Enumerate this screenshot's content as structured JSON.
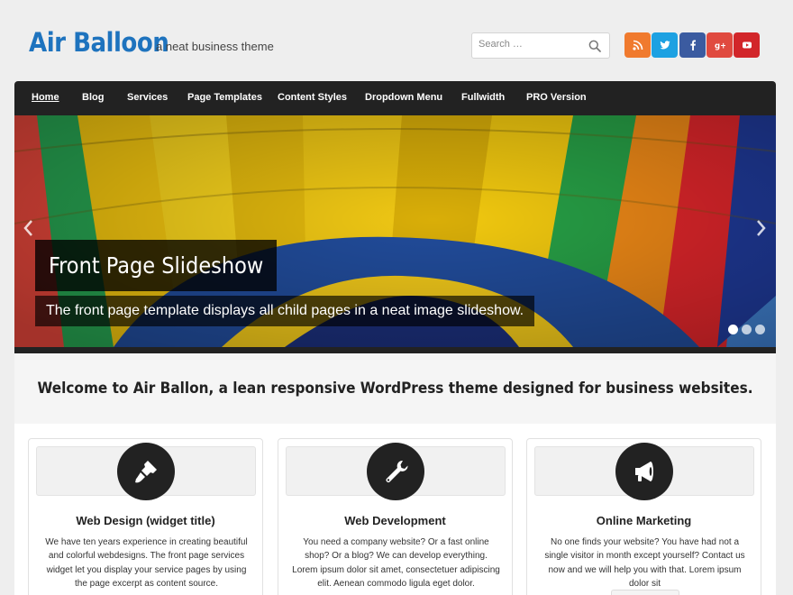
{
  "header": {
    "site_title": "Air Balloon",
    "tagline": "a neat business theme",
    "search_placeholder": "Search …",
    "social": [
      {
        "name": "rss",
        "color": "#f07a2e",
        "glyph": "rss-icon"
      },
      {
        "name": "twitter",
        "color": "#1da1e2",
        "glyph": "twitter-icon"
      },
      {
        "name": "facebook",
        "color": "#3b5ba0",
        "glyph": "facebook-icon"
      },
      {
        "name": "google-plus",
        "color": "#e04a3f",
        "glyph": "google-plus-icon"
      },
      {
        "name": "youtube",
        "color": "#d2262a",
        "glyph": "youtube-icon"
      }
    ]
  },
  "nav": {
    "items": [
      {
        "label": "Home",
        "active": true
      },
      {
        "label": "Blog"
      },
      {
        "label": "Services"
      },
      {
        "label": "Page Templates"
      },
      {
        "label": "Content Styles"
      },
      {
        "label": "Dropdown Menu"
      },
      {
        "label": "Fullwidth"
      },
      {
        "label": "PRO Version"
      }
    ]
  },
  "slideshow": {
    "title": "Front Page Slideshow",
    "caption": "The front page template displays all child pages in a neat image slideshow.",
    "slide_count": 3,
    "active_slide": 1
  },
  "intro": {
    "text": "Welcome to Air Ballon, a lean responsive WordPress theme designed for business websites."
  },
  "services": [
    {
      "title": "Web Design (widget title)",
      "icon": "paintbrush-icon",
      "text": "We have ten years experience in creating beautiful and colorful webdesigns. The front page services widget let you display your service pages by using the page excerpt as content source."
    },
    {
      "title": "Web Development",
      "icon": "wrench-icon",
      "text": "You need a company website? Or a fast online shop? Or a blog? We can develop everything. Lorem ipsum dolor sit amet, consectetuer adipiscing elit. Aenean commodo ligula eget dolor."
    },
    {
      "title": "Online Marketing",
      "icon": "megaphone-icon",
      "text": "No one finds your website? You have had not a single visitor in month except yourself? Contact us now and we will help you with that. Lorem ipsum dolor sit"
    }
  ],
  "colors": {
    "accent": "#1e73be",
    "nav_bg": "#222222"
  }
}
